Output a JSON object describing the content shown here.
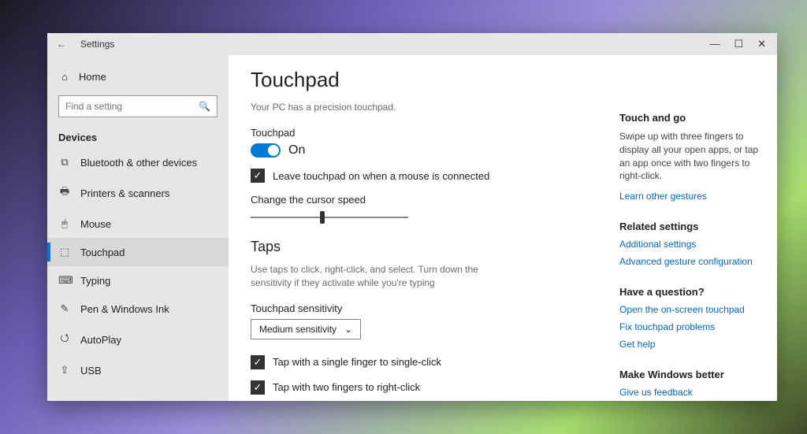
{
  "window": {
    "title": "Settings"
  },
  "sidebar": {
    "home": "Home",
    "search_placeholder": "Find a setting",
    "category": "Devices",
    "items": [
      {
        "icon": "⧉",
        "label": "Bluetooth & other devices"
      },
      {
        "icon": "🖶",
        "label": "Printers & scanners"
      },
      {
        "icon": "🖱",
        "label": "Mouse"
      },
      {
        "icon": "⬚",
        "label": "Touchpad"
      },
      {
        "icon": "⌨",
        "label": "Typing"
      },
      {
        "icon": "✎",
        "label": "Pen & Windows Ink"
      },
      {
        "icon": "⭯",
        "label": "AutoPlay"
      },
      {
        "icon": "⇪",
        "label": "USB"
      }
    ],
    "active_index": 3
  },
  "main": {
    "heading": "Touchpad",
    "precision_note": "Your PC has a precision touchpad.",
    "touchpad_label": "Touchpad",
    "toggle_state": "On",
    "leave_on_label": "Leave touchpad on when a mouse is connected",
    "cursor_speed_label": "Change the cursor speed",
    "taps_heading": "Taps",
    "taps_desc": "Use taps to click, right-click, and select. Turn down the sensitivity if they activate while you're typing",
    "sensitivity_label": "Touchpad sensitivity",
    "sensitivity_value": "Medium sensitivity",
    "tap_single": "Tap with a single finger to single-click",
    "tap_double": "Tap with two fingers to right-click"
  },
  "rail": {
    "touch_and_go": {
      "title": "Touch and go",
      "body": "Swipe up with three fingers to display all your open apps, or tap an app once with two fingers to right-click.",
      "link": "Learn other gestures"
    },
    "related": {
      "title": "Related settings",
      "links": [
        "Additional settings",
        "Advanced gesture configuration"
      ]
    },
    "question": {
      "title": "Have a question?",
      "links": [
        "Open the on-screen touchpad",
        "Fix touchpad problems",
        "Get help"
      ]
    },
    "better": {
      "title": "Make Windows better",
      "links": [
        "Give us feedback"
      ]
    }
  }
}
